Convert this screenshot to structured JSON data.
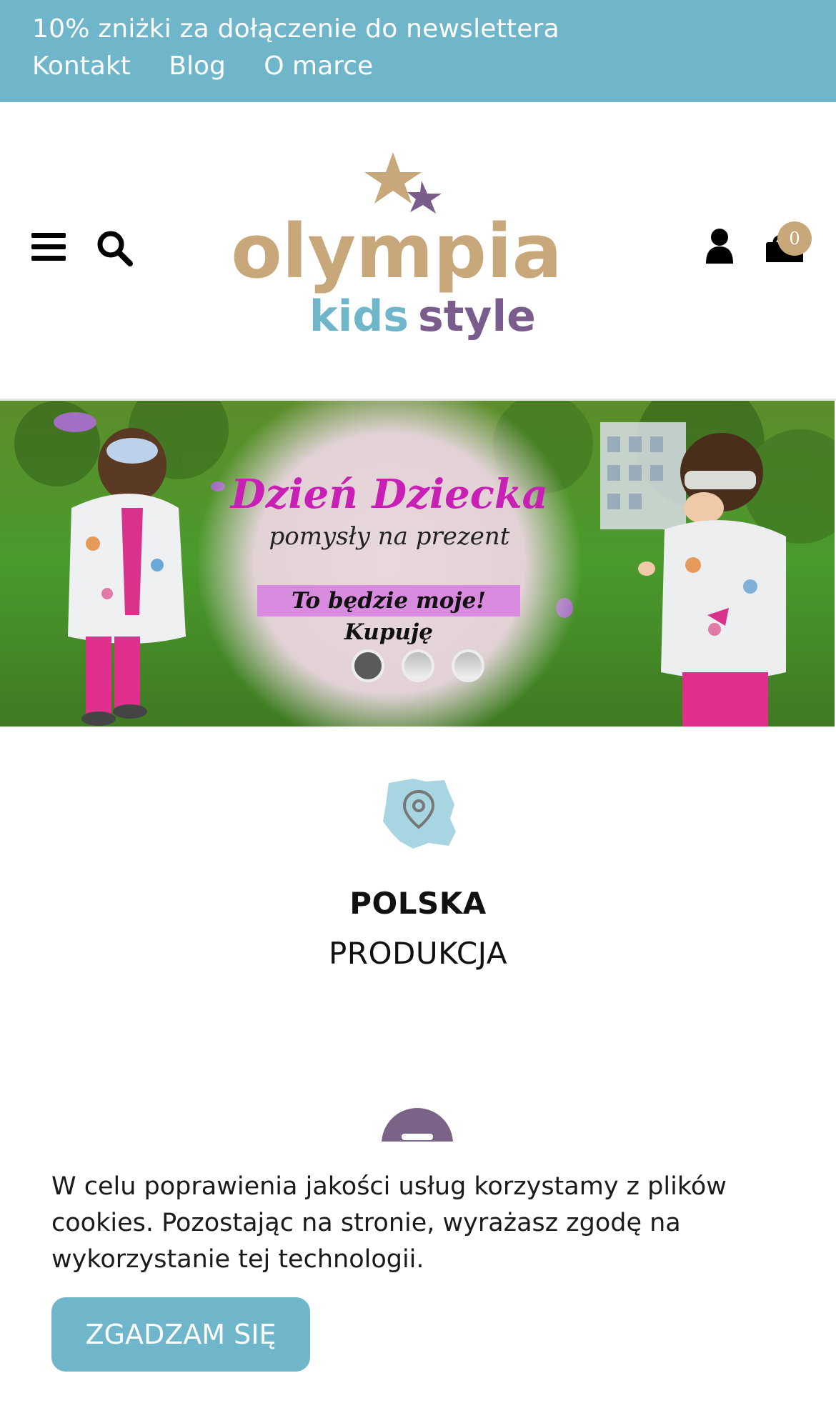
{
  "topbar": {
    "promo": "10% zniżki za dołączenie do newslettera",
    "links": [
      "Kontakt",
      "Blog",
      "O marce"
    ],
    "bg_color": "#6fb6cb"
  },
  "header": {
    "logo_text_main": "olympia",
    "logo_text_sub_1": "kids",
    "logo_text_sub_2": "style",
    "icons": [
      "menu-icon",
      "search-icon",
      "user-icon",
      "cart-icon"
    ],
    "cart_count": "0"
  },
  "banner": {
    "title": "Dzień Dziecka",
    "subtitle": "pomysły na prezent",
    "cta": "To będzie moje! Kupuję",
    "slides": 3,
    "active_slide": 1
  },
  "feature": {
    "icon": "poland-map-pin-icon",
    "title": "POLSKA",
    "subtitle": "PRODUKCJA"
  },
  "cookie": {
    "text": "W celu poprawienia jakości usług korzystamy z plików cookies. Pozostając na stronie, wyrażasz zgodę na wykorzystanie tej technologii.",
    "button": "ZGADZAM SIĘ"
  }
}
